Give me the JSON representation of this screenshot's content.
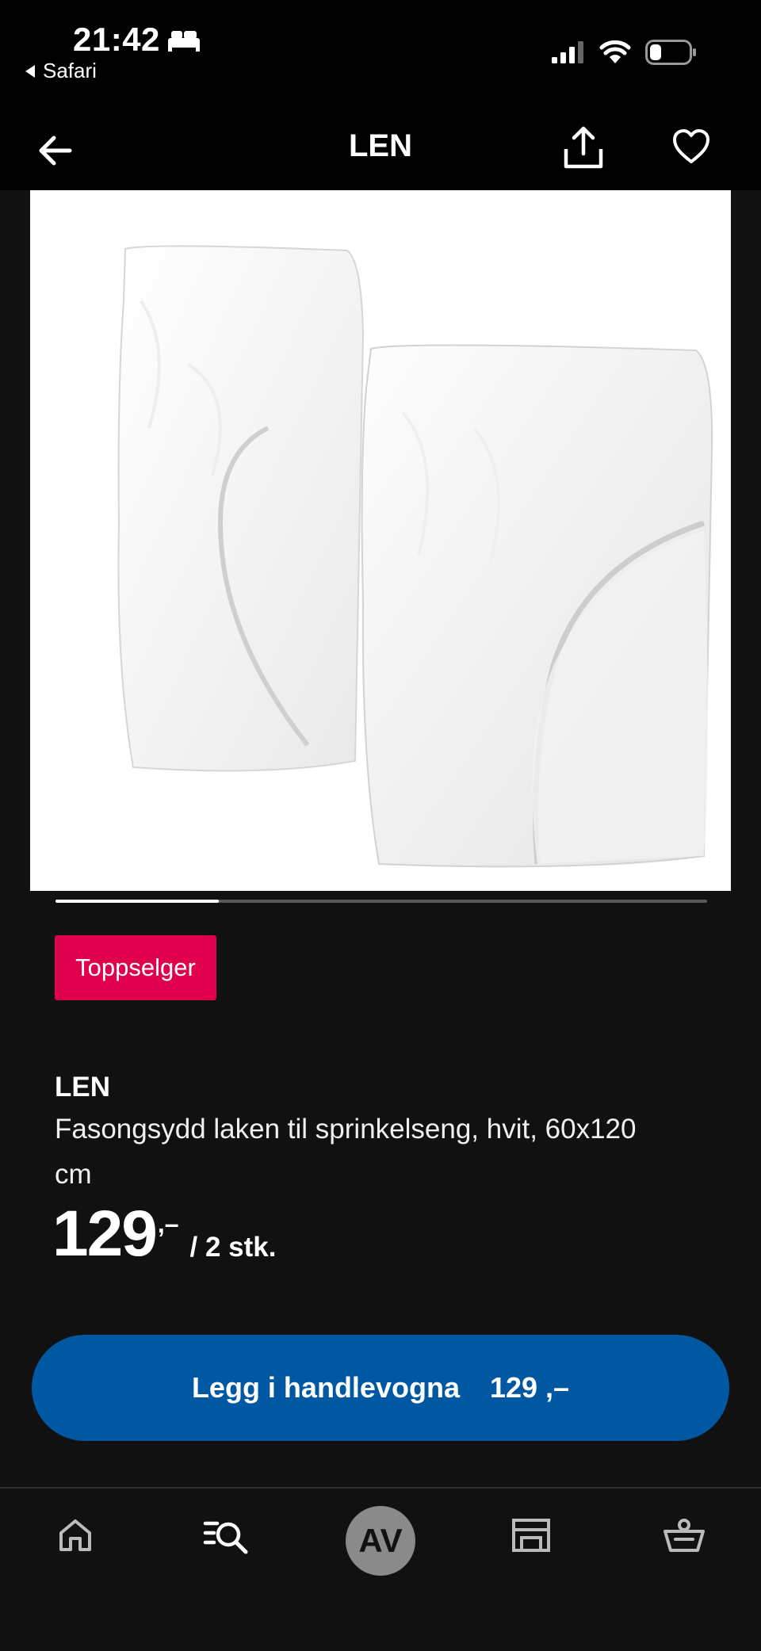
{
  "status_bar": {
    "time": "21:42",
    "back_app": "Safari",
    "icons": [
      "bed-icon",
      "signal-icon",
      "wifi-icon",
      "battery-icon"
    ]
  },
  "nav": {
    "title": "LEN",
    "icons": [
      "arrow-left-icon",
      "share-icon",
      "heart-icon"
    ]
  },
  "product": {
    "image_alt": "LEN fasongsydd laken, hvit",
    "carousel_progress": 0.25,
    "badge": "Toppselger",
    "name": "LEN",
    "description": "Fasongsydd laken til sprinkelseng, hvit, 60x120 cm",
    "price_integer": "129",
    "price_decimal": ",–",
    "price_unit": "/ 2 stk."
  },
  "cart_button": {
    "label": "Legg i handlevogna",
    "price": "129 ,–"
  },
  "tab_bar": {
    "items": [
      {
        "name": "home",
        "icon": "home-icon"
      },
      {
        "name": "search",
        "icon": "search-list-icon"
      },
      {
        "name": "profile",
        "avatar_initials": "AV"
      },
      {
        "name": "store",
        "icon": "store-icon"
      },
      {
        "name": "cart",
        "icon": "basket-icon"
      }
    ]
  },
  "colors": {
    "background": "#111111",
    "badge": "#e0004d",
    "primary_button": "#0058a3",
    "avatar": "#8a8a8a"
  }
}
